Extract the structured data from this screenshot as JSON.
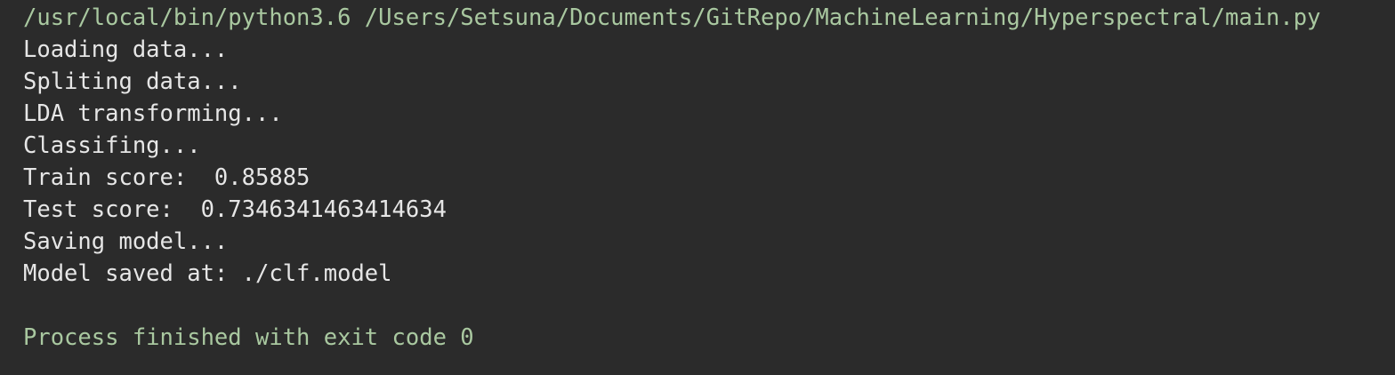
{
  "console": {
    "colors": {
      "background": "#2b2b2b",
      "stdout": "#e6e6e6",
      "system": "#a9c8a0"
    },
    "command": "/usr/local/bin/python3.6 /Users/Setsuna/Documents/GitRepo/MachineLearning/Hyperspectral/main.py",
    "output_lines": [
      "Loading data...",
      "Spliting data...",
      "LDA transforming...",
      "Classifing...",
      "Train score:  0.85885",
      "Test score:  0.7346341463414634",
      "Saving model...",
      "Model saved at: ./clf.model"
    ],
    "exit_message": "Process finished with exit code 0"
  }
}
